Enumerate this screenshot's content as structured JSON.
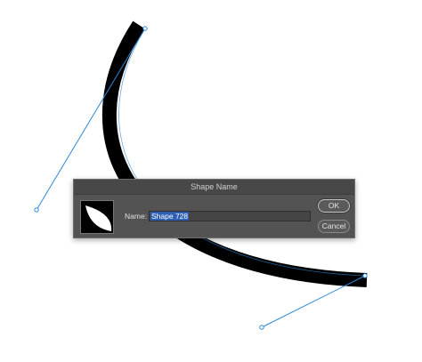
{
  "dialog": {
    "title": "Shape Name",
    "name_label": "Name:",
    "name_value": "Shape 728",
    "ok_label": "OK",
    "cancel_label": "Cancel"
  },
  "colors": {
    "stroke": "#000000",
    "path_line": "#2f88d8",
    "dialog_bg": "#535353",
    "selection": "#2f5fb3"
  }
}
